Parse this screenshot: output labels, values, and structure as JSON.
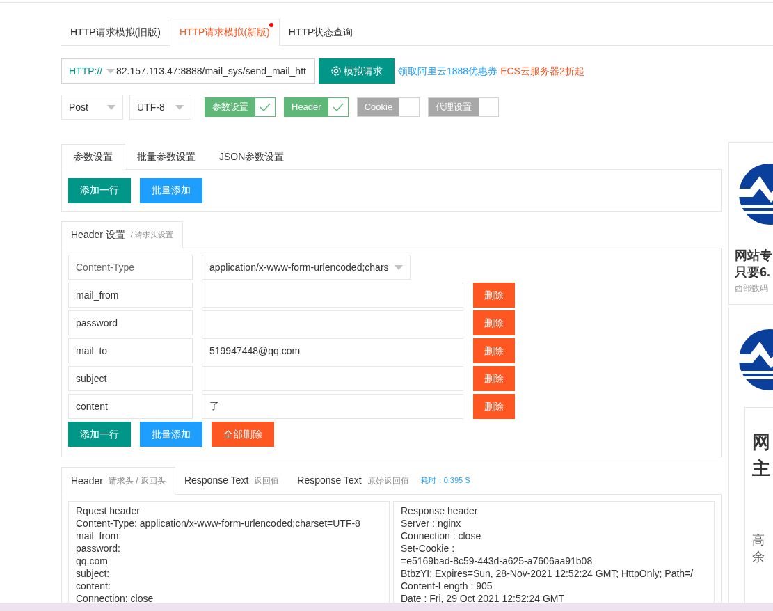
{
  "top_tabs": [
    {
      "label": "HTTP请求模拟(旧版)",
      "selected": false,
      "dot": false
    },
    {
      "label": "HTTP请求模拟(新版)",
      "selected": true,
      "dot": true
    },
    {
      "label": "HTTP状态查询",
      "selected": false,
      "dot": false
    }
  ],
  "url_bar": {
    "protocol": "HTTP://",
    "url": "82.157.113.47:8888/mail_sys/send_mail_htt",
    "submit": "模拟请求",
    "promo_links": [
      {
        "label": "领取阿里云1888优惠券",
        "color": "#1e9fff"
      },
      {
        "label": "ECS云服务器2折起",
        "color": "#ff5722"
      }
    ]
  },
  "method": "Post",
  "charset": "UTF-8",
  "toggles": [
    {
      "label": "参数设置",
      "on": true
    },
    {
      "label": "Header",
      "on": true
    },
    {
      "label": "Cookie",
      "on": false
    },
    {
      "label": "代理设置",
      "on": false
    }
  ],
  "param_tabs": [
    {
      "label": "参数设置",
      "selected": true
    },
    {
      "label": "批量参数设置",
      "selected": false
    },
    {
      "label": "JSON参数设置",
      "selected": false
    }
  ],
  "param_buttons": [
    "添加一行",
    "批量添加"
  ],
  "header_section": {
    "title": "Header 设置",
    "subtitle": "/ 请求头设置",
    "content_type": {
      "name_placeholder": "Content-Type",
      "value": "application/x-www-form-urlencoded;chars"
    },
    "rows": [
      {
        "name": "mail_from",
        "value": "",
        "delete": "删除"
      },
      {
        "name": "password",
        "value": "",
        "delete": "删除"
      },
      {
        "name": "mail_to",
        "value": "519947448@qq.com",
        "delete": "删除"
      },
      {
        "name": "subject",
        "value": "",
        "delete": "删除"
      },
      {
        "name": "content",
        "value": "了",
        "delete": "删除"
      }
    ],
    "buttons": [
      "添加一行",
      "批量添加",
      "全部删除"
    ]
  },
  "result_tabs": [
    {
      "label": "Header",
      "sub": "请求头 / 返回头",
      "selected": true
    },
    {
      "label": "Response Text",
      "sub": "返回值",
      "selected": false
    },
    {
      "label": "Response Text",
      "sub": "原始返回值",
      "selected": false
    }
  ],
  "elapsed": "耗时：0.395 S",
  "request_header": [
    "Rquest header",
    "Content-Type: application/x-www-form-urlencoded;charset=UTF-8",
    "mail_from:",
    "password:",
    "qq.com",
    "subject:",
    "content:",
    "Connection: close"
  ],
  "response_header": [
    "Response header",
    "Server : nginx",
    "Connection : close",
    "Set-Cookie :",
    "=e5169bad-8c59-443d-a625-a7606aa91b08",
    "BtbzYI; Expires=Sun, 28-Nov-2021 12:52:24 GMT; HttpOnly; Path=/",
    "Content-Length : 905",
    "Date : Fri, 29 Oct 2021 12:52:24 GMT"
  ],
  "ads": [
    {
      "lines": [
        "网站专",
        "只要6."
      ],
      "source": "西部数码"
    },
    {
      "lines": [
        "网",
        "主"
      ],
      "footer": [
        "高",
        "余"
      ]
    }
  ]
}
